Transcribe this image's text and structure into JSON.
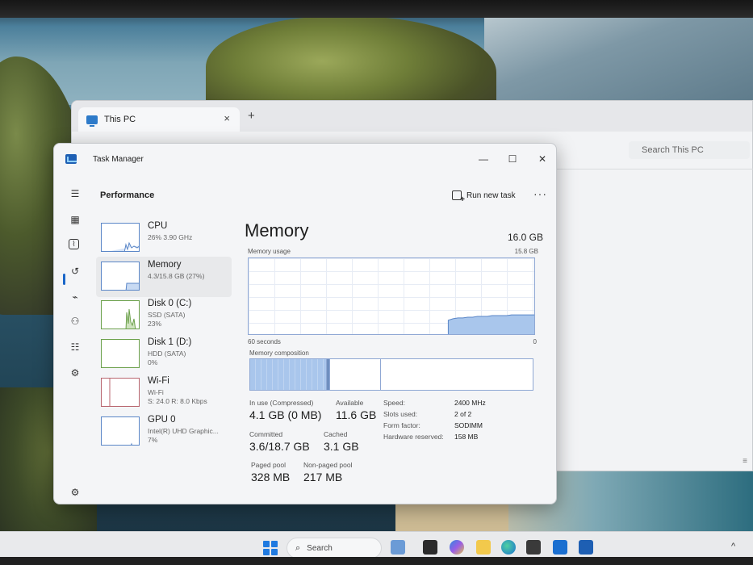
{
  "explorer": {
    "tab_label": "This PC",
    "close_glyph": "×",
    "new_tab_glyph": "+",
    "search_placeholder": "Search This PC"
  },
  "task_manager": {
    "title": "Task Manager",
    "section_title": "Performance",
    "run_new_task_label": "Run new task",
    "more_glyph": "···",
    "window_controls": {
      "minimize": "—",
      "maximize": "☐",
      "close": "✕"
    }
  },
  "nav_icons": [
    "hamburger-menu-icon",
    "processes-icon",
    "performance-icon",
    "app-history-icon",
    "startup-apps-icon",
    "users-icon",
    "details-icon",
    "services-icon",
    "settings-icon"
  ],
  "resources": [
    {
      "name": "CPU",
      "sub": "26%  3.90 GHz",
      "sub2": ""
    },
    {
      "name": "Memory",
      "sub": "4.3/15.8 GB (27%)",
      "sub2": ""
    },
    {
      "name": "Disk 0 (C:)",
      "sub": "SSD (SATA)",
      "sub2": "23%"
    },
    {
      "name": "Disk 1 (D:)",
      "sub": "HDD (SATA)",
      "sub2": "0%"
    },
    {
      "name": "Wi-Fi",
      "sub": "Wi-Fi",
      "sub2": "S: 24.0  R: 8.0 Kbps"
    },
    {
      "name": "GPU 0",
      "sub": "Intel(R) UHD Graphic...",
      "sub2": "7%"
    }
  ],
  "memory": {
    "title": "Memory",
    "total": "16.0 GB",
    "usage_label": "Memory usage",
    "usage_max": "15.8 GB",
    "axis_left": "60 seconds",
    "axis_right": "0",
    "composition_label": "Memory composition",
    "composition": {
      "in_use_fraction": 0.27,
      "modified_fraction": 0.012,
      "standby_fraction": 0.18
    },
    "usage_history_fraction": [
      0,
      0,
      0,
      0,
      0,
      0,
      0,
      0,
      0,
      0,
      0,
      0,
      0,
      0,
      0,
      0,
      0,
      0,
      0,
      0,
      0,
      0,
      0,
      0,
      0,
      0,
      0,
      0,
      0,
      0,
      0,
      0,
      0,
      0,
      0,
      0,
      0,
      0,
      0,
      0,
      0,
      0.2,
      0.22,
      0.23,
      0.23,
      0.24,
      0.24,
      0.25,
      0.25,
      0.25,
      0.26,
      0.26,
      0.26,
      0.26,
      0.27,
      0.27,
      0.27,
      0.27,
      0.27,
      0.27
    ],
    "stats": {
      "in_use_label": "In use (Compressed)",
      "in_use_value": "4.1 GB (0 MB)",
      "available_label": "Available",
      "available_value": "11.6 GB",
      "committed_label": "Committed",
      "committed_value": "3.6/18.7 GB",
      "cached_label": "Cached",
      "cached_value": "3.1 GB",
      "paged_label": "Paged pool",
      "paged_value": "328 MB",
      "nonpaged_label": "Non-paged pool",
      "nonpaged_value": "217 MB"
    },
    "specs": {
      "speed_label": "Speed:",
      "speed_value": "2400 MHz",
      "slots_label": "Slots used:",
      "slots_value": "2 of 2",
      "form_label": "Form factor:",
      "form_value": "SODIMM",
      "reserved_label": "Hardware reserved:",
      "reserved_value": "158 MB"
    }
  },
  "taskbar": {
    "search_label": "Search",
    "apps": [
      "files-icon",
      "task-view-icon",
      "copilot-icon",
      "file-explorer-icon",
      "edge-icon",
      "store-icon",
      "outlook-icon",
      "task-manager-icon"
    ],
    "chevron_glyph": "^"
  },
  "colors": {
    "memory_accent": "#5a86c7",
    "disk_accent": "#6ba04a",
    "wifi_accent": "#b8656e"
  }
}
